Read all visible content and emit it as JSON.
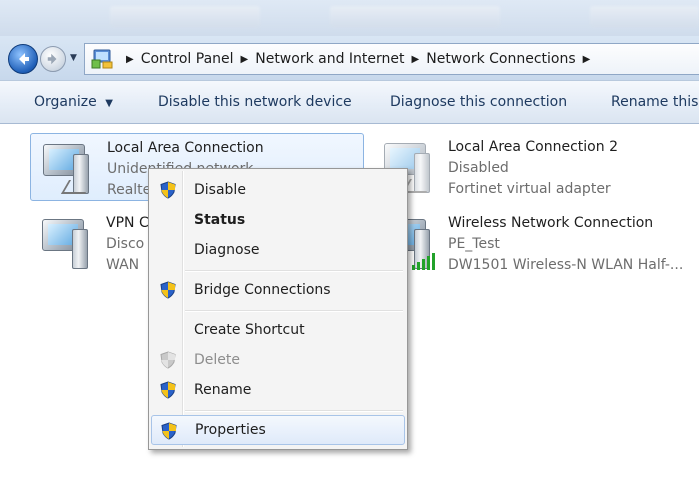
{
  "address": {
    "crumbs": [
      "Control Panel",
      "Network and Internet",
      "Network Connections"
    ]
  },
  "commands": {
    "organize": "Organize",
    "disable_device": "Disable this network device",
    "diagnose": "Diagnose this connection",
    "rename": "Rename this"
  },
  "connections": [
    {
      "name": "Local Area Connection",
      "status": "Unidentified network",
      "adapter": "Realte"
    },
    {
      "name": "Local Area Connection 2",
      "status": "Disabled",
      "adapter": "Fortinet virtual adapter"
    },
    {
      "name": "VPN C",
      "status": "Disco",
      "adapter": "WAN"
    },
    {
      "name": "Wireless Network Connection",
      "status": "PE_Test",
      "adapter": "DW1501 Wireless-N WLAN Half-..."
    }
  ],
  "context_menu": {
    "items": [
      {
        "label": "Disable"
      },
      {
        "label": "Status"
      },
      {
        "label": "Diagnose"
      },
      {
        "label": "Bridge Connections"
      },
      {
        "label": "Create Shortcut"
      },
      {
        "label": "Delete"
      },
      {
        "label": "Rename"
      },
      {
        "label": "Properties"
      }
    ]
  },
  "colors": {
    "selection": "#dfedfd",
    "shield_blue": "#2a62c9",
    "shield_yellow": "#f3c21b"
  }
}
